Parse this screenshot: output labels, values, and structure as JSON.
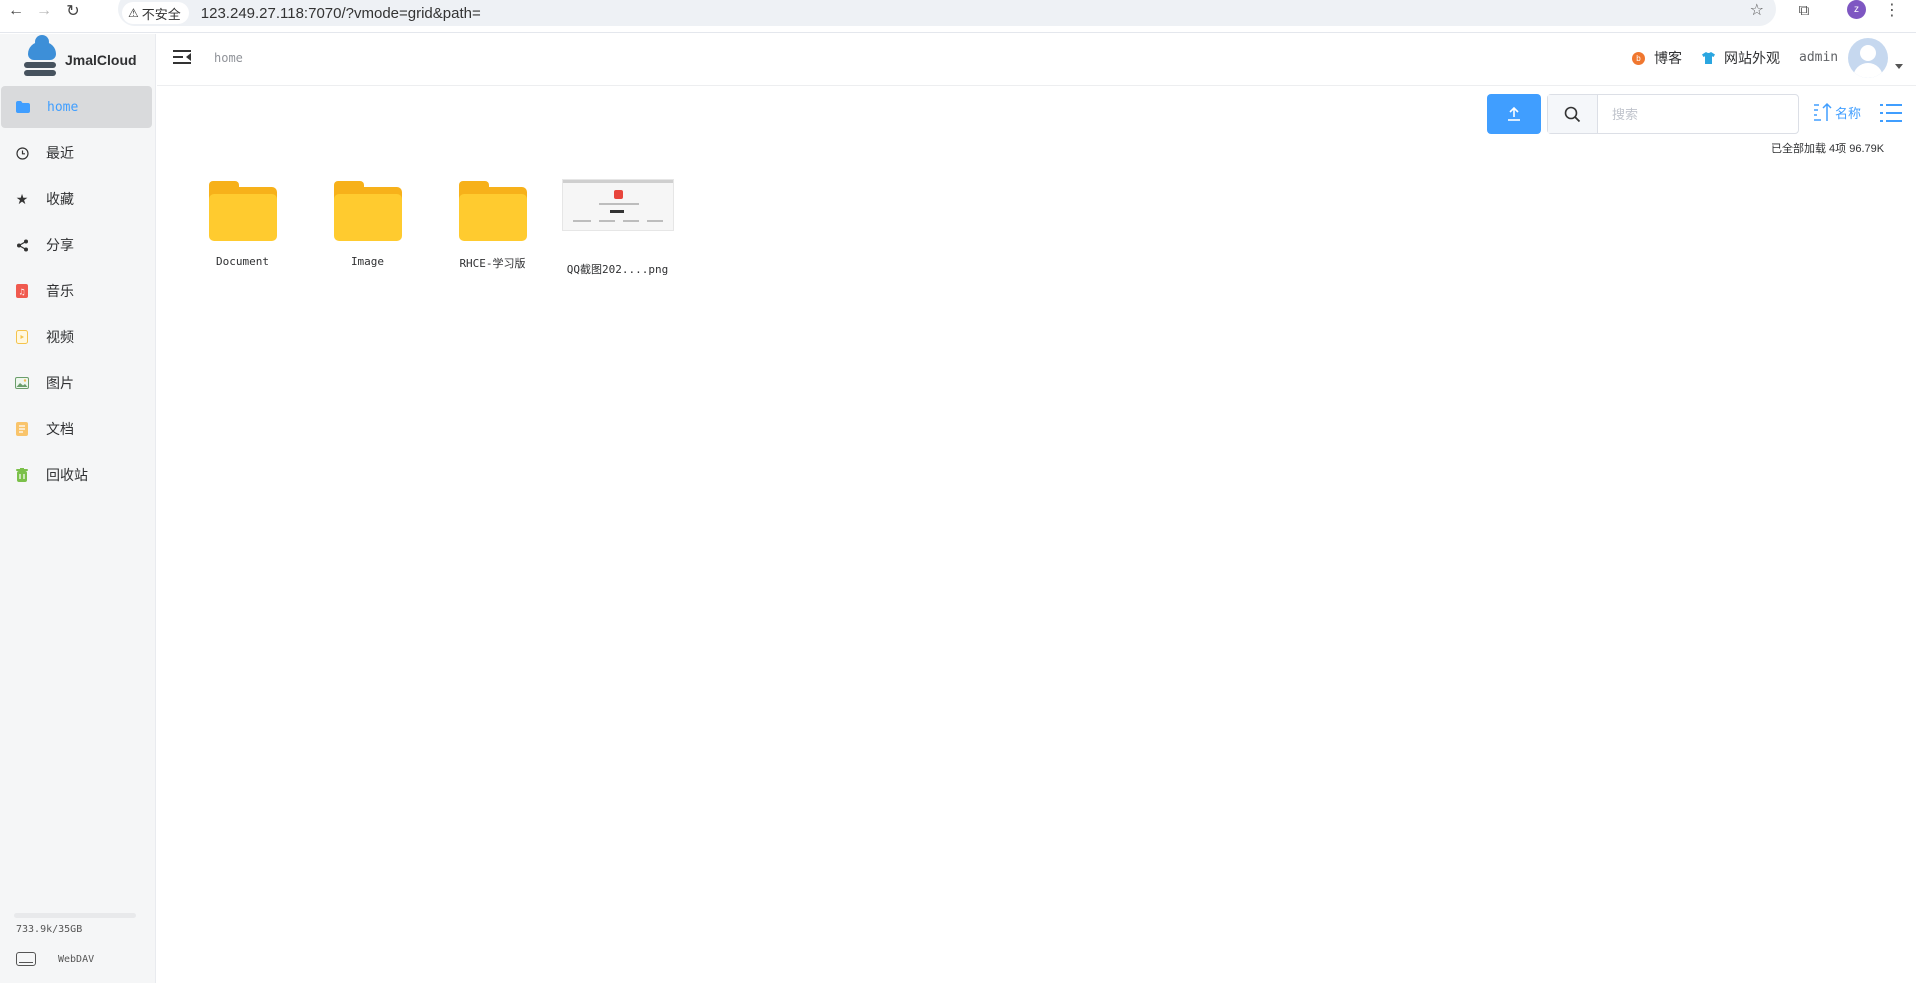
{
  "browser": {
    "security_label": "不安全",
    "url": "123.249.27.118:7070/?vmode=grid&path=",
    "profile_initial": "z"
  },
  "app": {
    "name": "JmalCloud"
  },
  "sidebar": {
    "items": [
      {
        "label": "home",
        "icon": "folder-icon",
        "active": true
      },
      {
        "label": "最近",
        "icon": "clock-icon"
      },
      {
        "label": "收藏",
        "icon": "star-icon"
      },
      {
        "label": "分享",
        "icon": "share-icon"
      },
      {
        "label": "音乐",
        "icon": "music-icon"
      },
      {
        "label": "视频",
        "icon": "video-icon"
      },
      {
        "label": "图片",
        "icon": "image-icon"
      },
      {
        "label": "文档",
        "icon": "document-icon"
      },
      {
        "label": "回收站",
        "icon": "trash-icon"
      }
    ],
    "storage_text": "733.9k/35GB",
    "storage_used_fraction": 0.0,
    "webdav_label": "WebDAV"
  },
  "header": {
    "breadcrumb": "home",
    "blog_label": "博客",
    "appearance_label": "网站外观",
    "username": "admin"
  },
  "toolbar": {
    "search_placeholder": "搜索",
    "sort_label": "名称",
    "summary": "已全部加载  4项  96.79K"
  },
  "files": [
    {
      "name": "Document",
      "type": "folder"
    },
    {
      "name": "Image",
      "type": "folder"
    },
    {
      "name": "RHCE-学习版",
      "type": "folder"
    },
    {
      "name": "QQ截图202....png",
      "type": "image"
    }
  ],
  "colors": {
    "accent": "#409eff",
    "folder": "#ffcb2f",
    "blog_icon": "#f0772f",
    "appearance_icon": "#2ba6e0",
    "music_icon": "#f05a4f",
    "trash_icon": "#7bc04a"
  }
}
